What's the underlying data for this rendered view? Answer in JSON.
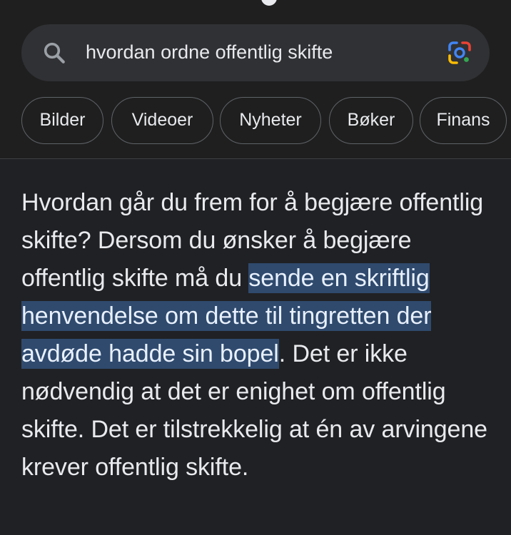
{
  "search": {
    "query": "hvordan ordne offentlig skifte",
    "icon": "search-icon",
    "lens_icon": "google-lens-icon"
  },
  "chips": [
    {
      "label": "Bilder"
    },
    {
      "label": "Videoer"
    },
    {
      "label": "Nyheter"
    },
    {
      "label": "Bøker"
    },
    {
      "label": "Finans"
    }
  ],
  "answer": {
    "before": "Hvordan går du frem for å begjære offentlig skifte? Dersom du ønsker å begjære offentlig skifte må du ",
    "highlight": "sende en skriftlig henvendelse om dette til tingretten der avdøde hadde sin bopel",
    "after": ". Det er ikke nødvendig at det er enighet om offentlig skifte. Det er tilstrekkelig at én av arvingene krever offentlig skifte."
  },
  "colors": {
    "background": "#202124",
    "search_bg": "#303134",
    "highlight_bg": "#2f4a6d",
    "text": "#e8eaed"
  }
}
